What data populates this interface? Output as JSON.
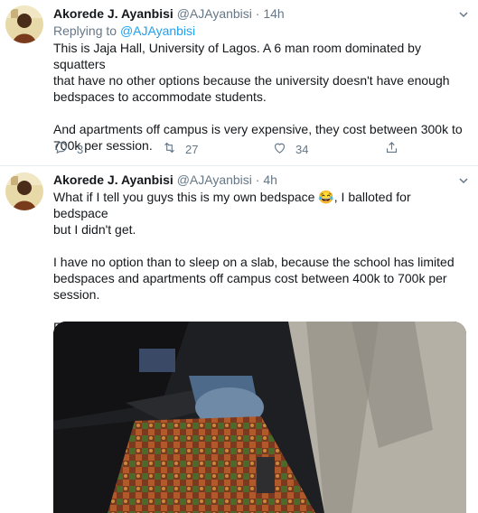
{
  "tweet1": {
    "name": "Akorede J. Ayanbisi",
    "handle": "@AJAyanbisi",
    "dot": "·",
    "time": "14h",
    "replying_prefix": "Replying to ",
    "replying_to": "@AJAyanbisi",
    "text": "This is Jaja Hall, University of Lagos. A 6 man room dominated by squatters\nthat have no other options because the university doesn't have enough\nbedspaces to accommodate students.\n\nAnd apartments off campus is very expensive, they cost between 300k to\n700k per session.",
    "replies": "3",
    "retweets": "27",
    "likes": "34"
  },
  "tweet2": {
    "name": "Akorede J. Ayanbisi",
    "handle": "@AJAyanbisi",
    "dot": "·",
    "time": "4h",
    "text": "What if I tell you guys this is my own bedspace 😂, I balloted for bedspace\nbut I didn't get.\n\nI have no option than to sleep on a slab, because the school has limited\nbedspaces and apartments off campus cost between 400k to 700k per\nsession.\n\nFederal uni needs to do better."
  },
  "colors": {
    "link": "#1da1f2",
    "muted": "#657786",
    "text": "#14171a",
    "divider": "#e6ecf0"
  },
  "icons": [
    "avatar",
    "chevron-down-icon",
    "reply-icon",
    "retweet-icon",
    "like-icon",
    "share-icon"
  ]
}
